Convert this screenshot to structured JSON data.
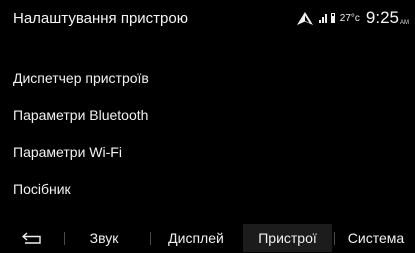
{
  "header": {
    "title": "Налаштування пристрою",
    "temperature": "27°c",
    "time": "9:25",
    "ampm": "AM"
  },
  "menu": {
    "items": [
      {
        "label": "Диспетчер пристроїв"
      },
      {
        "label": "Параметри Bluetooth"
      },
      {
        "label": "Параметри Wi-Fi"
      },
      {
        "label": "Посібник"
      }
    ]
  },
  "tabs": {
    "back_icon": "back-arrow-icon",
    "items": [
      {
        "label": "Звук"
      },
      {
        "label": "Дисплей"
      },
      {
        "label": "Пристрої",
        "active": true
      },
      {
        "label": "Система"
      }
    ]
  },
  "colors": {
    "background": "#000000",
    "text": "#f2f2f2",
    "active_tab": "#1c1c1c"
  }
}
